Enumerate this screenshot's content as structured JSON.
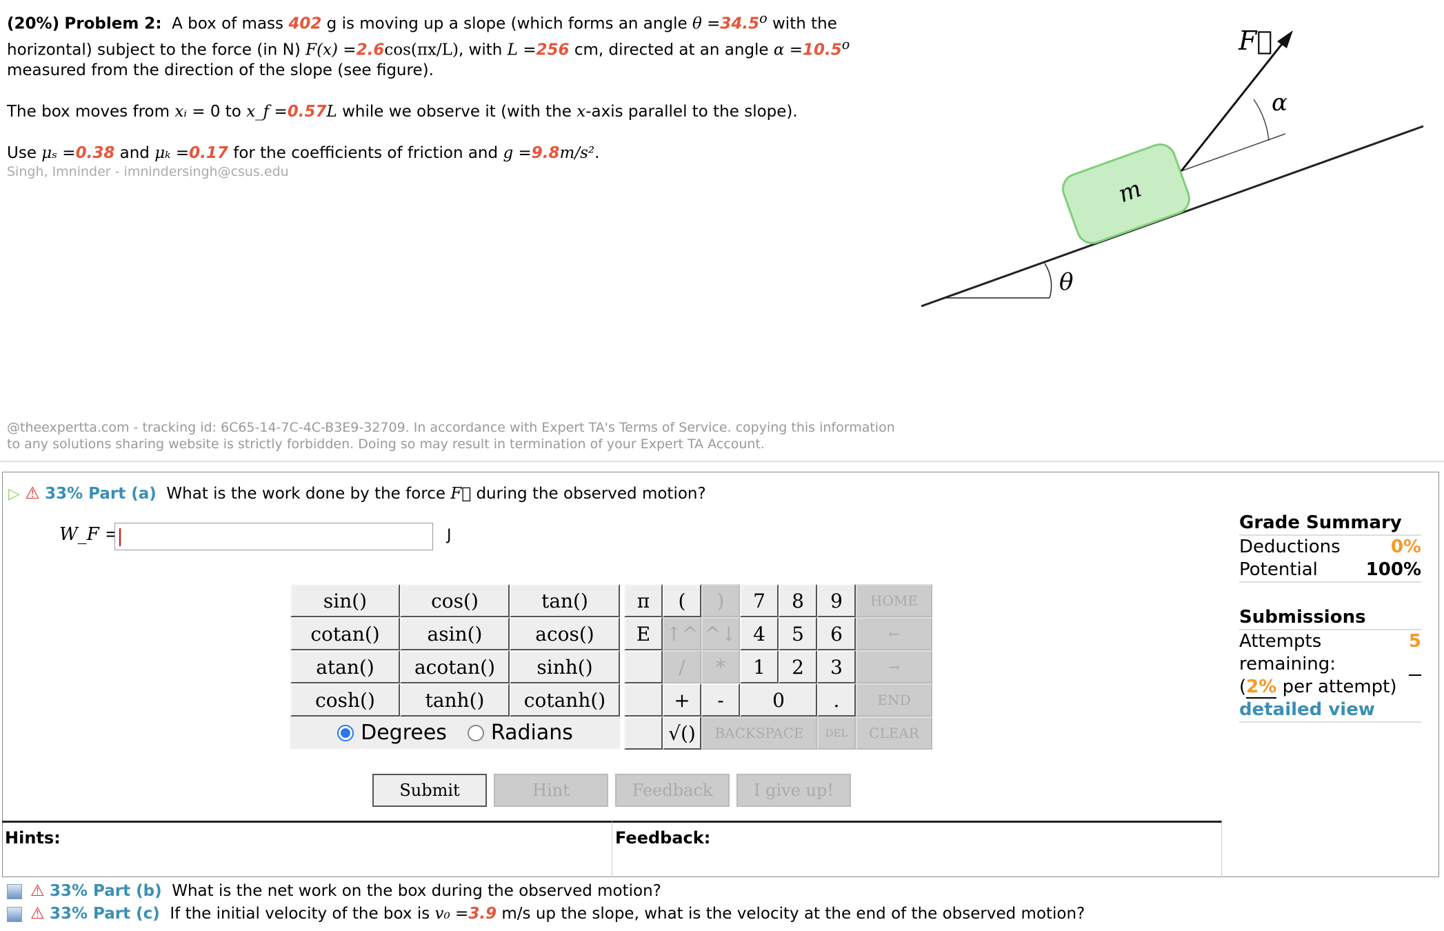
{
  "problem": {
    "pct": "(20%)",
    "title": "Problem 2:",
    "l1a": "A box of mass ",
    "mass": "402",
    "l1b": " g is moving up a slope (which forms an angle ",
    "theta_sym": "θ",
    "eq": " =",
    "theta": "34.5",
    "deg": "o",
    "l1c": " with the horizontal) subject to the force (in N) ",
    "fx": "F(x)",
    "amp": "2.6",
    "cos": "cos(πx/L)",
    "l1d": ", with ",
    "L": "L",
    "Lval": "256",
    "l1e": " cm, directed at an angle ",
    "alpha_sym": "α",
    "alpha": "10.5",
    "l1f": " measured from the direction of the slope (see figure).",
    "l2a": "The box moves from ",
    "xi": "xᵢ",
    "l2b": " = 0 to ",
    "xf": "x_f",
    "xfval": "0.57",
    "l2c": " while we observe it (with the ",
    "x": "x",
    "l2d": "-axis parallel to the slope).",
    "l3a": "Use ",
    "mus": "μₛ",
    "mus_val": "0.38",
    "l3b": " and ",
    "muk": "μₖ",
    "muk_val": "0.17",
    "l3c": " for the coefficients of friction and ",
    "g": "g",
    "g_val": "9.8",
    "g_unit": "m/s²",
    "dot": ".",
    "author": "Singh, Imninder - imnindersingh@csus.edu"
  },
  "figure": {
    "force_label": "F⃗",
    "alpha_label": "α",
    "mass_label": "m",
    "theta_label": "θ",
    "box_color": "#c8ecc4",
    "box_border": "#7fcf7a"
  },
  "footer": "@theexpertta.com - tracking id: 6C65-14-7C-4C-B3E9-32709. In accordance with Expert TA's Terms of Service. copying this information to any solutions sharing website is strictly forbidden. Doing so may result in termination of your Expert TA Account.",
  "part_a": {
    "pct": "33% Part (a)",
    "question": "What is the work done by the force ",
    "F": "F⃗",
    "q2": " during the observed motion?",
    "var": "W_F =",
    "value": "",
    "unit": "J"
  },
  "functions": [
    "sin()",
    "cos()",
    "tan()",
    "cotan()",
    "asin()",
    "acos()",
    "atan()",
    "acotan()",
    "sinh()",
    "cosh()",
    "tanh()",
    "cotanh()"
  ],
  "keypad": [
    "π",
    "(",
    ")",
    "7",
    "8",
    "9",
    "HOME",
    "E",
    "↑^",
    "^↓",
    "4",
    "5",
    "6",
    "←",
    "",
    "/",
    "*",
    "1",
    "2",
    "3",
    "→",
    "",
    "+",
    "-",
    "0",
    ".",
    "END",
    "",
    "√()",
    "BACKSPACE",
    "DEL",
    "CLEAR"
  ],
  "angle_mode": {
    "degrees": "Degrees",
    "radians": "Radians",
    "selected": "Degrees"
  },
  "buttons": {
    "submit": "Submit",
    "hint": "Hint",
    "feedback": "Feedback",
    "give_up": "I give up!"
  },
  "hints_label": "Hints:",
  "feedback_label": "Feedback:",
  "grade": {
    "title": "Grade Summary",
    "deductions_label": "Deductions",
    "deductions": "0%",
    "potential_label": "Potential",
    "potential": "100%",
    "sub_title": "Submissions",
    "attempts_label": "Attempts remaining: ",
    "attempts": "5",
    "per_open": "(",
    "per_pct": "2%",
    "per_label": " per attempt)",
    "detailed": "detailed view"
  },
  "part_b": {
    "pct": "33% Part (b)",
    "question": "What is the net work on the box during the observed motion?"
  },
  "part_c": {
    "pct": "33% Part (c)",
    "q1": "If the initial velocity of the box is ",
    "v0": "v₀",
    "eq": " =",
    "v0val": "3.9",
    "q2": " m/s up the slope, what is the velocity at the end of the observed motion?"
  },
  "colors": {
    "value": "#e8553b",
    "part": "#3a8fb5",
    "orange": "#f39a2b"
  }
}
